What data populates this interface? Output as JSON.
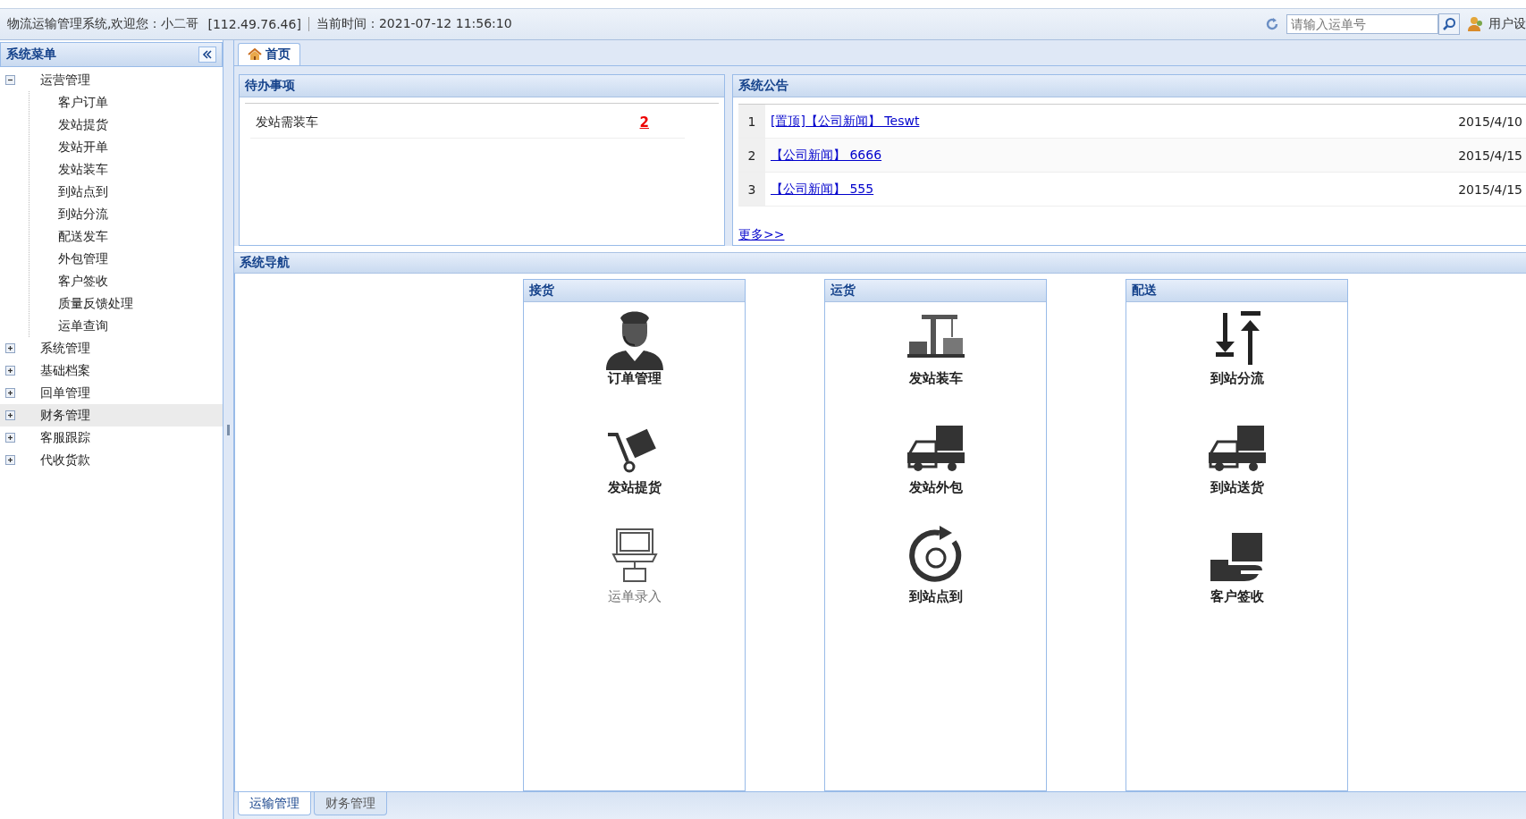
{
  "top_bar": {
    "welcome": "物流运输管理系统,欢迎您：小二哥",
    "ip": "[112.49.76.46]",
    "time": "当前时间：2021-07-12 11:56:10",
    "search": {
      "placeholder": "请输入运单号"
    },
    "user_settings": "用户设"
  },
  "sidebar": {
    "title": "系统菜单",
    "items": [
      {
        "label": "运营管理",
        "expanded": true,
        "selected": false,
        "children": [
          {
            "label": "客户订单"
          },
          {
            "label": "发站提货"
          },
          {
            "label": "发站开单"
          },
          {
            "label": "发站装车"
          },
          {
            "label": "到站点到"
          },
          {
            "label": "到站分流"
          },
          {
            "label": "配送发车"
          },
          {
            "label": "外包管理"
          },
          {
            "label": "客户签收"
          },
          {
            "label": "质量反馈处理"
          },
          {
            "label": "运单查询"
          }
        ]
      },
      {
        "label": "系统管理",
        "expanded": false,
        "selected": false
      },
      {
        "label": "基础档案",
        "expanded": false,
        "selected": false
      },
      {
        "label": "回单管理",
        "expanded": false,
        "selected": false
      },
      {
        "label": "财务管理",
        "expanded": false,
        "selected": true
      },
      {
        "label": "客服跟踪",
        "expanded": false,
        "selected": false
      },
      {
        "label": "代收货款",
        "expanded": false,
        "selected": false
      }
    ]
  },
  "tabs": [
    {
      "label": "首页",
      "selected": true
    }
  ],
  "todo": {
    "title": "待办事项",
    "rows": [
      {
        "label": "发站需装车",
        "count": "2"
      }
    ]
  },
  "notices": {
    "title": "系统公告",
    "rows": [
      {
        "index": "1",
        "title": "[置顶]【公司新闻】 Teswt",
        "date": "2015/4/10"
      },
      {
        "index": "2",
        "title": "【公司新闻】 6666",
        "date": "2015/4/15"
      },
      {
        "index": "3",
        "title": "【公司新闻】 555",
        "date": "2015/4/15"
      }
    ],
    "more": "更多>>"
  },
  "navigation": {
    "title": "系统导航",
    "columns": [
      {
        "title": "接货",
        "items": [
          {
            "label": "订单管理",
            "disabled": false
          },
          {
            "label": "发站提货",
            "disabled": false
          },
          {
            "label": "运单录入",
            "disabled": true
          }
        ]
      },
      {
        "title": "运货",
        "items": [
          {
            "label": "发站装车",
            "disabled": false
          },
          {
            "label": "发站外包",
            "disabled": false
          },
          {
            "label": "到站点到",
            "disabled": false
          }
        ]
      },
      {
        "title": "配送",
        "items": [
          {
            "label": "到站分流",
            "disabled": false
          },
          {
            "label": "到站送货",
            "disabled": false
          },
          {
            "label": "客户签收",
            "disabled": false
          }
        ]
      }
    ]
  },
  "bottom_tabs": [
    {
      "label": "运输管理",
      "selected": true
    },
    {
      "label": "财务管理",
      "selected": false
    }
  ]
}
